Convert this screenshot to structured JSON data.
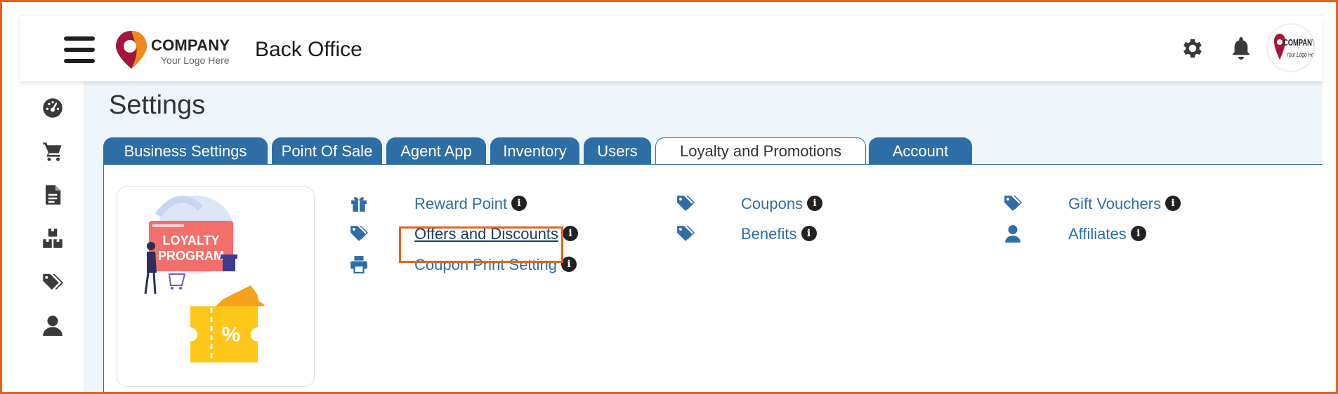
{
  "header": {
    "logo_company": "COMPANY",
    "logo_tagline": "Your Logo Here",
    "app_title": "Back Office",
    "avatar_company": "COMPANY",
    "avatar_tagline": "Your Logo Here"
  },
  "sidebar": {
    "items": [
      {
        "icon": "dashboard-icon"
      },
      {
        "icon": "cart-icon"
      },
      {
        "icon": "document-icon"
      },
      {
        "icon": "boxes-icon"
      },
      {
        "icon": "tags-icon"
      },
      {
        "icon": "user-icon"
      }
    ]
  },
  "page": {
    "title": "Settings"
  },
  "tabs": [
    {
      "label": "Business Settings"
    },
    {
      "label": "Point Of Sale"
    },
    {
      "label": "Agent App"
    },
    {
      "label": "Inventory"
    },
    {
      "label": "Users"
    },
    {
      "label": "Loyalty and Promotions",
      "active": true
    },
    {
      "label": "Account"
    }
  ],
  "illustration": {
    "line1": "LOYALTY",
    "line2": "PROGRAM"
  },
  "options": {
    "reward_point": {
      "label": "Reward Point",
      "icon": "gift-icon"
    },
    "offers_discounts": {
      "label": "Offers and Discounts",
      "icon": "tag-icon"
    },
    "coupon_print": {
      "label": "Coupon Print Setting",
      "icon": "printer-icon"
    },
    "coupons": {
      "label": "Coupons",
      "icon": "tag-icon"
    },
    "benefits": {
      "label": "Benefits",
      "icon": "tag-icon"
    },
    "gift_vouchers": {
      "label": "Gift Vouchers",
      "icon": "tag-icon"
    },
    "affiliates": {
      "label": "Affiliates",
      "icon": "user-icon"
    },
    "info_glyph": "i"
  },
  "colors": {
    "accent": "#2f6ea5",
    "highlight": "#e8621c",
    "content_bg": "#eef6fc"
  }
}
